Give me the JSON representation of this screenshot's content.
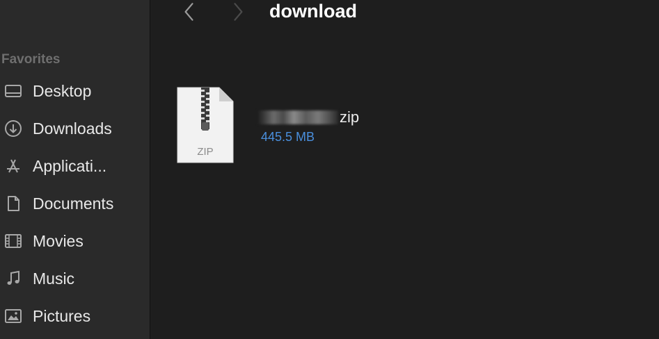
{
  "window": {
    "title": "download"
  },
  "sidebar": {
    "heading": "Favorites",
    "items": [
      {
        "label": "Desktop",
        "icon": "desktop-icon"
      },
      {
        "label": "Downloads",
        "icon": "download-icon"
      },
      {
        "label": "Applicati...",
        "icon": "applications-icon"
      },
      {
        "label": "Documents",
        "icon": "document-icon"
      },
      {
        "label": "Movies",
        "icon": "film-icon"
      },
      {
        "label": "Music",
        "icon": "music-note-icon"
      },
      {
        "label": "Pictures",
        "icon": "photo-icon"
      }
    ]
  },
  "files": [
    {
      "name_suffix": "zip",
      "size": "445.5 MB",
      "icon": "zip-file-icon",
      "icon_label": "ZIP"
    }
  ],
  "colors": {
    "accent": "#4a8fdd",
    "background": "#1e1e1e",
    "sidebar": "#2a2a2a"
  }
}
